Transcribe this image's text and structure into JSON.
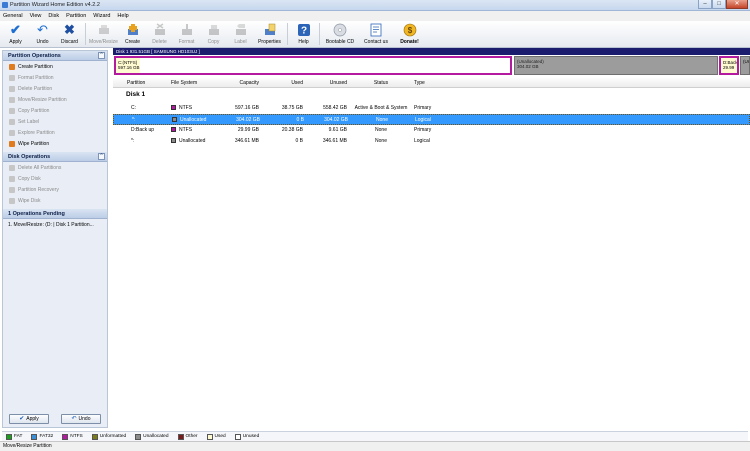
{
  "window": {
    "title": "Partition Wizard Home Edition v4.2.2"
  },
  "menu": [
    "General",
    "View",
    "Disk",
    "Partition",
    "Wizard",
    "Help"
  ],
  "toolbar": {
    "apply": "Apply",
    "undo": "Undo",
    "discard": "Discard",
    "move_resize": "Move/Resize",
    "create": "Create",
    "delete": "Delete",
    "format": "Format",
    "copy": "Copy",
    "label": "Label",
    "properties": "Properties",
    "help": "Help",
    "bootable_cd": "Bootable CD",
    "contact_us": "Contact us",
    "donate": "Donate!"
  },
  "sidebar": {
    "partition_ops_title": "Partition Operations",
    "partition_ops": [
      "Create Partition",
      "Format Partition",
      "Delete Partition",
      "Move/Resize Partition",
      "Copy Partition",
      "Set Label",
      "Explore Partition",
      "Wipe Partition"
    ],
    "disk_ops_title": "Disk Operations",
    "disk_ops": [
      "Delete All Partitions",
      "Copy Disk",
      "Partition Recovery",
      "Wipe Disk"
    ],
    "pending_title": "1 Operations Pending",
    "pending_items": [
      "1. Move/Resize: (D: | Disk 1 Partition..."
    ],
    "apply": "Apply",
    "undo": "Undo"
  },
  "diskmap": {
    "header": "Disk 1  931.51GB  [ SAMSUNG HD103UJ ]",
    "c_label": "C:(NTFS)",
    "c_size": "597.16 GB",
    "un1_label": "(Unallocated)",
    "un1_size": "304.02 GB",
    "d_label": "D:Back",
    "d_size": "29.99",
    "un2_label": "(Ur"
  },
  "table": {
    "headers": [
      "Partition",
      "File System",
      "Capacity",
      "Used",
      "Unused",
      "Status",
      "Type"
    ],
    "disk_label": "Disk 1",
    "rows": [
      {
        "partition": "C:",
        "fs": "NTFS",
        "capacity": "597.16 GB",
        "used": "38.75 GB",
        "unused": "558.42 GB",
        "status": "Active & Boot & System",
        "type": "Primary"
      },
      {
        "partition": "*:",
        "fs": "Unallocated",
        "capacity": "304.02 GB",
        "used": "0 B",
        "unused": "304.02 GB",
        "status": "None",
        "type": "Logical"
      },
      {
        "partition": "D:Back up",
        "fs": "NTFS",
        "capacity": "29.99 GB",
        "used": "20.38 GB",
        "unused": "9.61 GB",
        "status": "None",
        "type": "Primary"
      },
      {
        "partition": "*:",
        "fs": "Unallocated",
        "capacity": "346.61 MB",
        "used": "0 B",
        "unused": "346.61 MB",
        "status": "None",
        "type": "Logical"
      }
    ]
  },
  "legend": [
    "FAT",
    "FAT32",
    "NTFS",
    "Unformatted",
    "Unallocated",
    "Other",
    "Used",
    "Unused"
  ],
  "legend_colors": [
    "#1aa11a",
    "#3a8fd6",
    "#b31aa0",
    "#7a7a1a",
    "#8c8c8c",
    "#7a1a1a",
    "#fffbd0",
    "#ffffff"
  ],
  "colors": {
    "ntfs": "#b31aa0",
    "unallocated": "#8c8c8c",
    "selection": "#3399ff"
  },
  "statusbar": "Move/Resize Partition"
}
